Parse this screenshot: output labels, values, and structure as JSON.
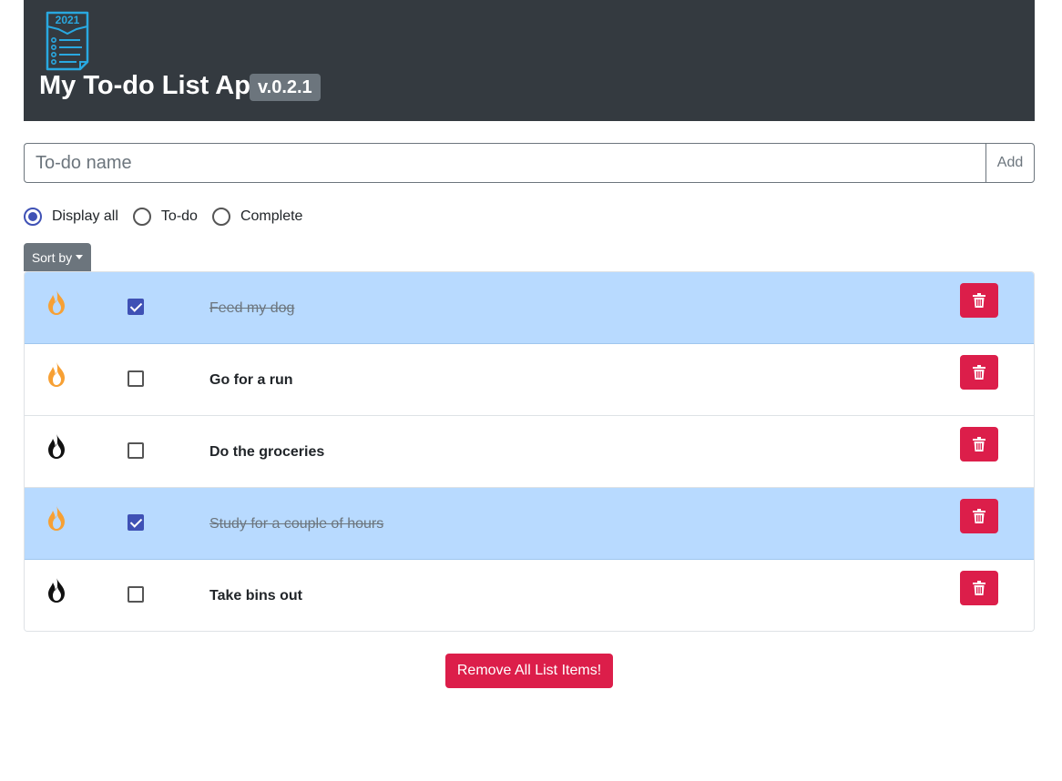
{
  "header": {
    "logo_text": "2021",
    "title": "My To-do List App",
    "version": "v.0.2.1"
  },
  "add_form": {
    "placeholder": "To-do name",
    "value": "",
    "add_label": "Add"
  },
  "filters": {
    "options": [
      {
        "label": "Display all",
        "checked": true
      },
      {
        "label": "To-do",
        "checked": false
      },
      {
        "label": "Complete",
        "checked": false
      }
    ]
  },
  "sort": {
    "label": "Sort by"
  },
  "todos": [
    {
      "text": "Feed my dog",
      "done": true,
      "priority": "high",
      "flame_color": "#f7a034"
    },
    {
      "text": "Go for a run",
      "done": false,
      "priority": "high",
      "flame_color": "#f7a034"
    },
    {
      "text": "Do the groceries",
      "done": false,
      "priority": "normal",
      "flame_color": "#111111"
    },
    {
      "text": "Study for a couple of hours",
      "done": true,
      "priority": "high",
      "flame_color": "#f7a034"
    },
    {
      "text": "Take bins out",
      "done": false,
      "priority": "normal",
      "flame_color": "#111111"
    }
  ],
  "footer": {
    "remove_all_label": "Remove All List Items!"
  },
  "colors": {
    "header_bg": "#343a40",
    "accent": "#3f51b5",
    "danger": "#dc1e4a",
    "done_row_bg": "#b8daff",
    "logo_stroke": "#29a8e0"
  }
}
